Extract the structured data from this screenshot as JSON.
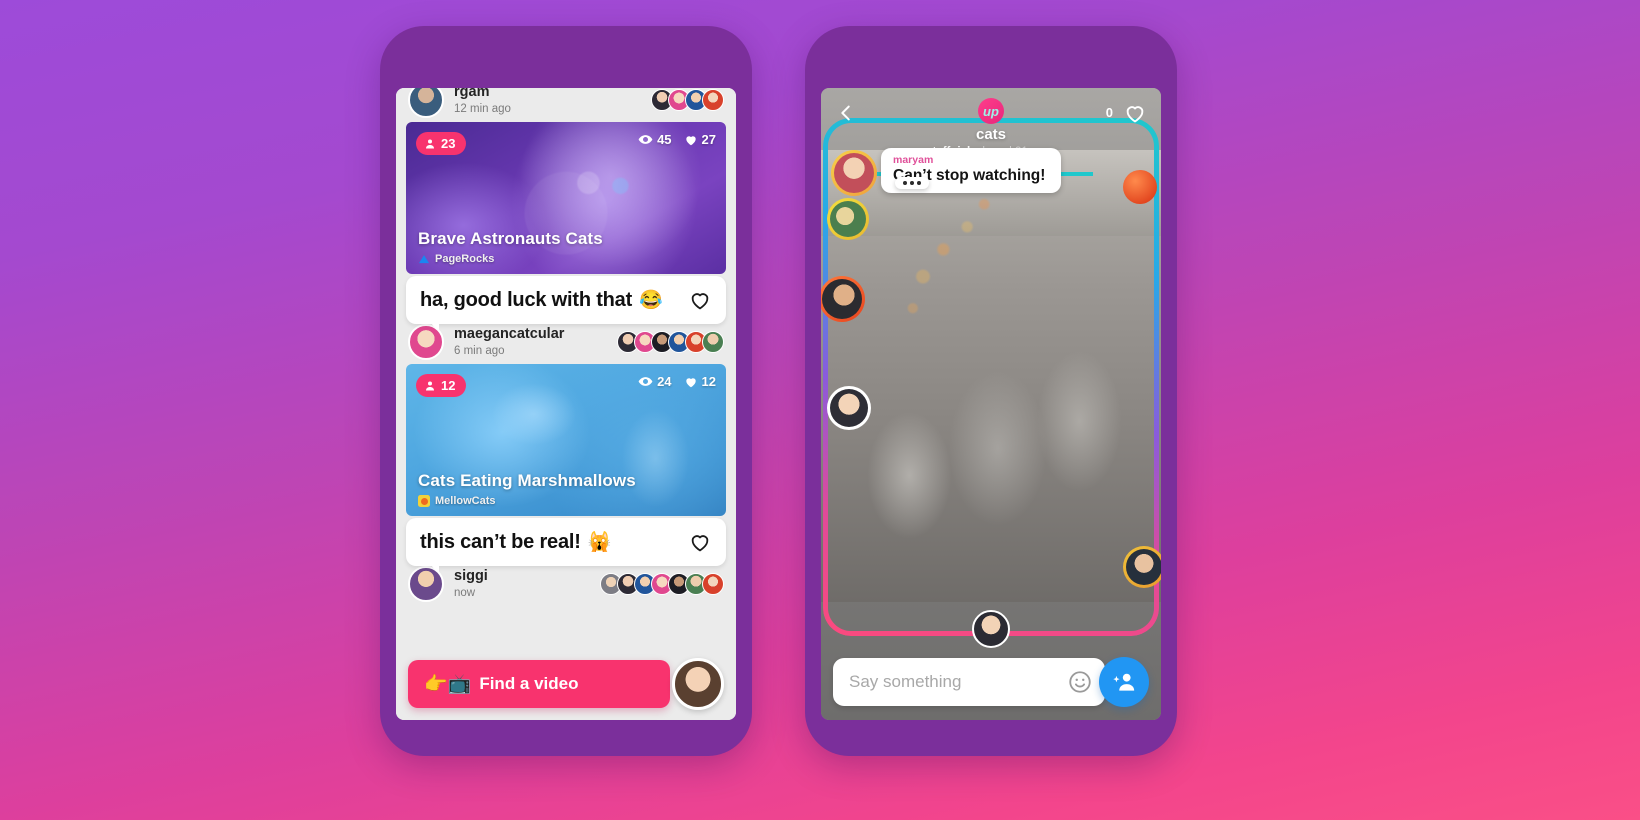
{
  "background": {
    "top_color": "#9d4bd9",
    "bottom_color": "#f8478a"
  },
  "left_phone": {
    "name": "video-feed-screen",
    "top_post": {
      "username": "rgam",
      "time": "12 min ago"
    },
    "posts": [
      {
        "viewer_badge": "23",
        "views": "45",
        "likes": "27",
        "title": "Brave Astronauts Cats",
        "source_name": "PageRocks",
        "source_icon": "triangle-icon",
        "comment": "ha, good luck with that",
        "comment_emoji": "😂",
        "commenter": "maegancatcular",
        "commenter_time": "6 min ago",
        "media_theme": "purple"
      },
      {
        "viewer_badge": "12",
        "views": "24",
        "likes": "12",
        "title": "Cats Eating Marshmallows",
        "source_name": "MellowCats",
        "source_icon": "dot-icon",
        "comment": "this can’t be real!",
        "comment_emoji": "🙀",
        "commenter": "siggi",
        "commenter_time": "now",
        "media_theme": "blue"
      }
    ],
    "find_video_button": {
      "label": "Find a video",
      "emoji": "👉📺",
      "color": "#f8336e"
    },
    "me_avatar": "self-avatar"
  },
  "right_phone": {
    "name": "watch-party-screen",
    "back_icon": "chevron-left-icon",
    "logo_text": "up",
    "room_name": "cats",
    "shared_by": "staffpick",
    "shared_meta": "shared 21s ago",
    "like_count": "0",
    "like_icon": "heart-outline-icon",
    "chat": {
      "username": "maryam",
      "message": "Can’t stop watching!",
      "typing_indicator": "•••"
    },
    "composer": {
      "placeholder": "Say something",
      "emoji_icon": "smiley-icon",
      "invite_icon": "add-person-icon",
      "invite_color": "#2196f3"
    },
    "participants": [
      {
        "name": "participant-1",
        "side": "left"
      },
      {
        "name": "participant-2",
        "side": "left"
      },
      {
        "name": "participant-3",
        "side": "left"
      },
      {
        "name": "participant-4",
        "side": "left"
      },
      {
        "name": "participant-5",
        "side": "right"
      },
      {
        "name": "host",
        "side": "bottom"
      }
    ],
    "accent_ring_colors": [
      "#1fc8cc",
      "#29a8e8",
      "#8a5bdc",
      "#e04a9a",
      "#fb4a7e"
    ]
  }
}
